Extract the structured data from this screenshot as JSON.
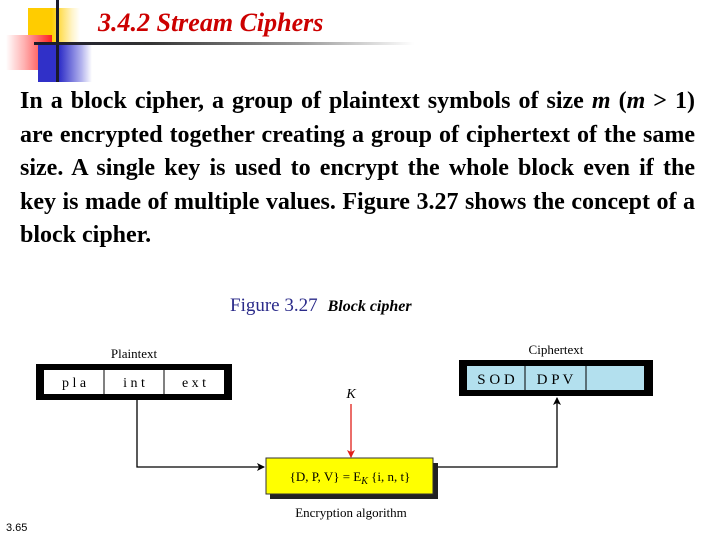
{
  "slide": {
    "title": "3.4.2  Stream Ciphers",
    "paragraph": {
      "p1": "In a block cipher, a group of plaintext symbols of size ",
      "m1": "m",
      "p2": " (",
      "m2": "m",
      "p3": " > 1) are encrypted together creating a group of ciphertext of the same size. A single key is used to encrypt the whole block even if the key is made of multiple values. Figure 3.27 shows the concept of a block cipher."
    },
    "figure": {
      "number": "Figure 3.27",
      "title": "Block cipher"
    },
    "slide_number": "3.65"
  },
  "diagram": {
    "plaintext_label": "Plaintext",
    "plaintext_blocks": [
      "p l a",
      "i n t",
      "e x t"
    ],
    "ciphertext_label": "Ciphertext",
    "ciphertext_blocks": [
      "S O D",
      "D P V",
      ""
    ],
    "key_label": "K",
    "equation": {
      "lhs": "{D, P, V} = E",
      "sub": "K",
      "rhs": " {i, n, t}"
    },
    "algorithm_label": "Encryption algorithm",
    "colors": {
      "plaintext_fill": "#ffffff",
      "ciphertext_fill": "#b3e0ee",
      "algorithm_fill": "#ffff00",
      "key_arrow": "#e0201a",
      "title": "#cc0000",
      "figure_number": "#2b2b8a"
    }
  }
}
